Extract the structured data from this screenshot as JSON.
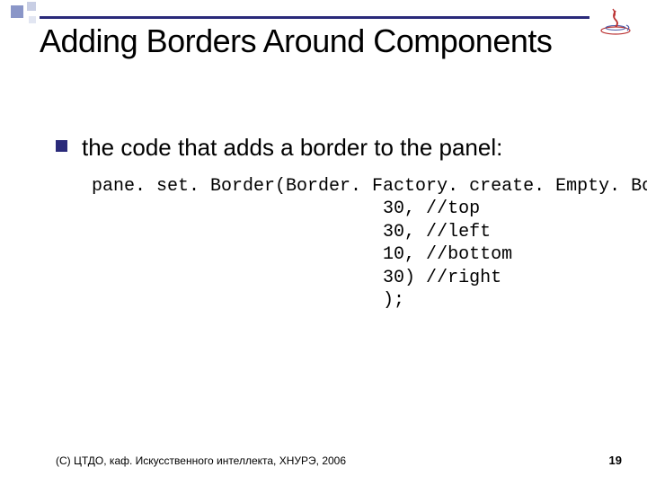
{
  "title": "Adding Borders Around Components",
  "bullet_text": "the code that adds a border to the panel:",
  "code": {
    "l1": "pane. set. Border(Border. Factory. create. Empty. Border(",
    "l2": "                           30, //top",
    "l3": "                           30, //left",
    "l4": "                           10, //bottom",
    "l5": "                           30) //right",
    "l6": "                           );"
  },
  "footer": {
    "copyright": "(С) ЦТДО, каф. Искусственного интеллекта, ХНУРЭ, 2006",
    "page": "19"
  }
}
